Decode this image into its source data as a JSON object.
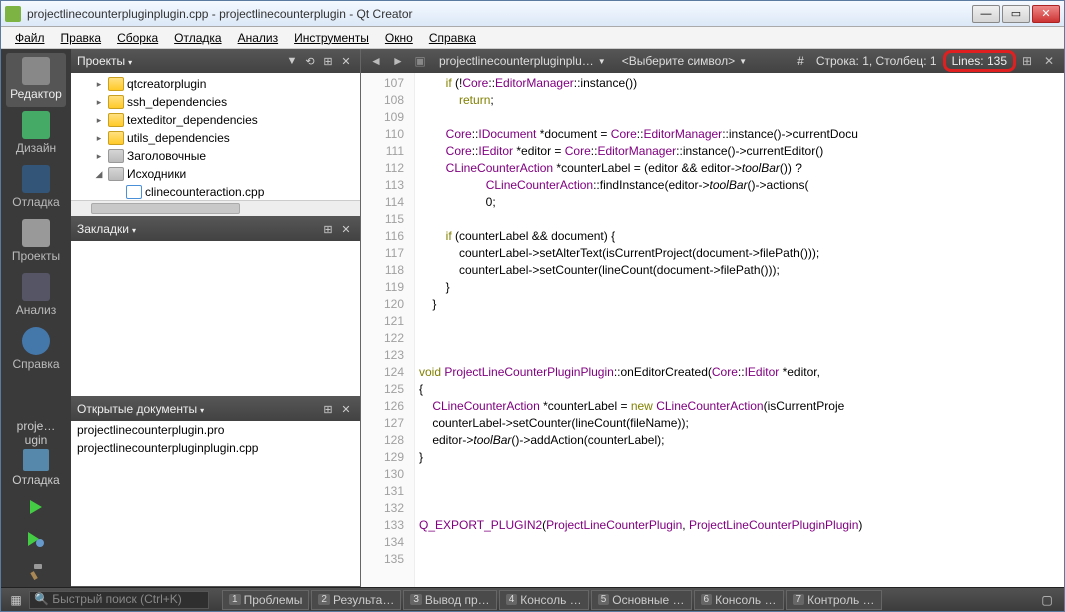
{
  "window": {
    "title": "projectlinecounterpluginplugin.cpp - projectlinecounterplugin - Qt Creator"
  },
  "menu": [
    "Файл",
    "Правка",
    "Сборка",
    "Отладка",
    "Анализ",
    "Инструменты",
    "Окно",
    "Справка"
  ],
  "modes": {
    "editor": "Редактор",
    "design": "Дизайн",
    "debug": "Отладка",
    "projects": "Проекты",
    "analyze": "Анализ",
    "help": "Справка"
  },
  "kit": {
    "project_short": "proje…ugin",
    "config": "Отладка"
  },
  "panes": {
    "projects": {
      "title": "Проекты",
      "items": [
        {
          "indent": 1,
          "tw": "▸",
          "icon": "folder-y",
          "label": "qtcreatorplugin"
        },
        {
          "indent": 1,
          "tw": "▸",
          "icon": "folder-y",
          "label": "ssh_dependencies"
        },
        {
          "indent": 1,
          "tw": "▸",
          "icon": "folder-y",
          "label": "texteditor_dependencies"
        },
        {
          "indent": 1,
          "tw": "▸",
          "icon": "folder-y",
          "label": "utils_dependencies"
        },
        {
          "indent": 1,
          "tw": "▸",
          "icon": "folder-g",
          "label": "Заголовочные"
        },
        {
          "indent": 1,
          "tw": "◢",
          "icon": "folder-g",
          "label": "Исходники"
        },
        {
          "indent": 2,
          "tw": "",
          "icon": "file-c",
          "label": "clinecounteraction.cpp"
        }
      ]
    },
    "bookmarks": {
      "title": "Закладки"
    },
    "opendocs": {
      "title": "Открытые документы",
      "docs": [
        "projectlinecounterplugin.pro",
        "projectlinecounterpluginplugin.cpp"
      ]
    }
  },
  "editor": {
    "file_dropdown": "projectlinecounterpluginplu…",
    "symbol_dropdown": "<Выберите символ>",
    "position": "Строка: 1, Столбец: 1",
    "lines_label": "Lines: 135",
    "first_line": 107,
    "lines": [
      "        if (!Core::EditorManager::instance())",
      "            return;",
      "",
      "        Core::IDocument *document = Core::EditorManager::instance()->currentDocu",
      "        Core::IEditor *editor = Core::EditorManager::instance()->currentEditor()",
      "        CLineCounterAction *counterLabel = (editor && editor->toolBar()) ?",
      "                    CLineCounterAction::findInstance(editor->toolBar()->actions(",
      "                    0;",
      "",
      "        if (counterLabel && document) {",
      "            counterLabel->setAlterText(isCurrentProject(document->filePath()));",
      "            counterLabel->setCounter(lineCount(document->filePath()));",
      "        }",
      "    }",
      "",
      "",
      "",
      "void ProjectLineCounterPluginPlugin::onEditorCreated(Core::IEditor *editor,",
      "{",
      "    CLineCounterAction *counterLabel = new CLineCounterAction(isCurrentProje",
      "    counterLabel->setCounter(lineCount(fileName));",
      "    editor->toolBar()->addAction(counterLabel);",
      "}",
      "",
      "",
      "",
      "Q_EXPORT_PLUGIN2(ProjectLineCounterPlugin, ProjectLineCounterPluginPlugin)",
      "",
      ""
    ]
  },
  "bottom": {
    "search_placeholder": "Быстрый поиск (Ctrl+K)",
    "tabs": [
      {
        "n": "1",
        "l": "Проблемы"
      },
      {
        "n": "2",
        "l": "Результа…"
      },
      {
        "n": "3",
        "l": "Вывод пр…"
      },
      {
        "n": "4",
        "l": "Консоль …"
      },
      {
        "n": "5",
        "l": "Основные …"
      },
      {
        "n": "6",
        "l": "Консоль …"
      },
      {
        "n": "7",
        "l": "Контроль …"
      }
    ]
  }
}
